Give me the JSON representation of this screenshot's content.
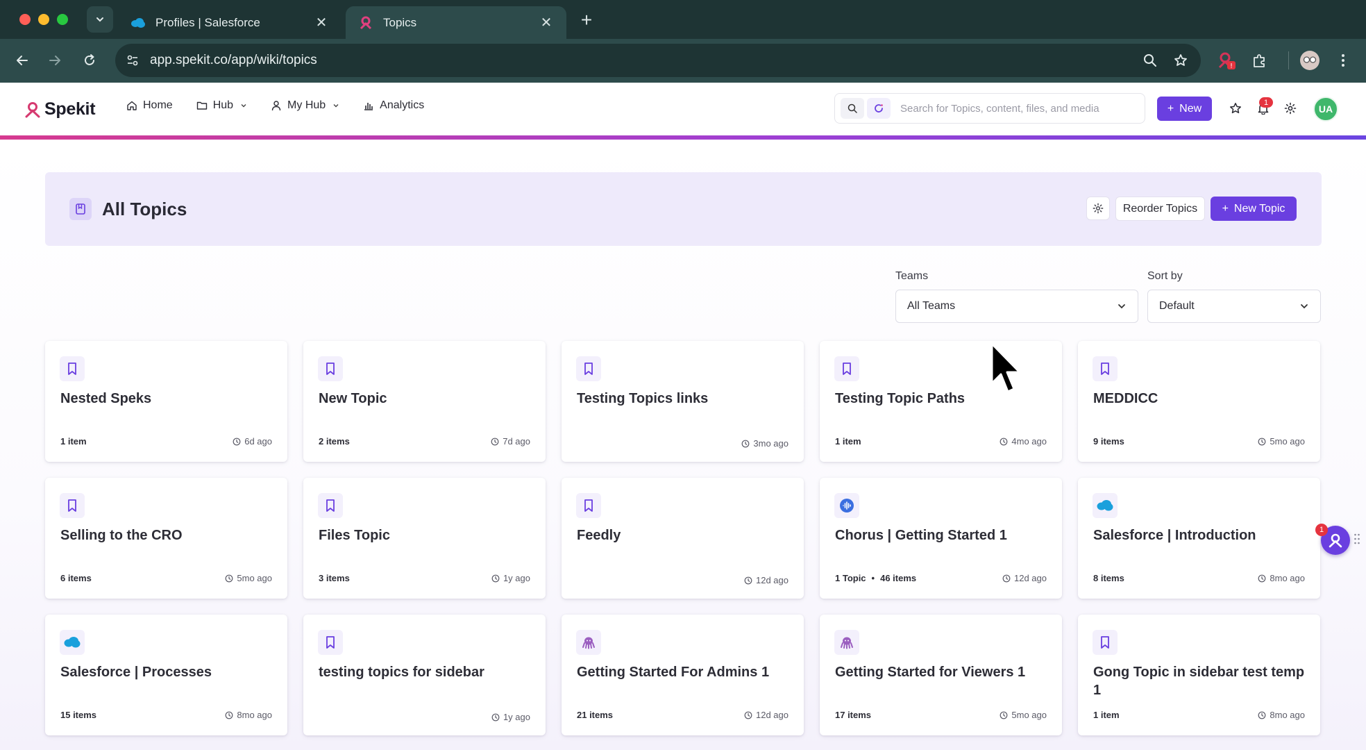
{
  "browser": {
    "tabs": [
      {
        "title": "Profiles | Salesforce",
        "favicon": "salesforce-cloud-icon"
      },
      {
        "title": "Topics",
        "favicon": "spekit-icon",
        "active": true
      }
    ],
    "url": "app.spekit.co/app/wiki/topics",
    "extension_badge": "!"
  },
  "app": {
    "logo_text": "Spekit",
    "nav": [
      {
        "label": "Home",
        "icon": "home-icon"
      },
      {
        "label": "Hub",
        "icon": "folder-icon",
        "dropdown": true
      },
      {
        "label": "My Hub",
        "icon": "user-icon",
        "dropdown": true
      },
      {
        "label": "Analytics",
        "icon": "bar-chart-icon"
      }
    ],
    "search_placeholder": "Search for Topics, content, files, and media",
    "new_button": "New",
    "notification_count": "1",
    "user_initials": "UA",
    "colors": {
      "primary": "#6a3fe0",
      "avatar": "#3fb76b",
      "hero_bg": "#eeeafb"
    }
  },
  "page": {
    "title": "All Topics",
    "reorder_label": "Reorder Topics",
    "new_topic_label": "New Topic",
    "filters": {
      "teams_label": "Teams",
      "teams_value": "All Teams",
      "sort_label": "Sort by",
      "sort_value": "Default"
    }
  },
  "topics": [
    {
      "title": "Nested Speks",
      "items": "1 item",
      "time": "6d ago",
      "icon": "bookmark-icon"
    },
    {
      "title": "New Topic",
      "items": "2 items",
      "time": "7d ago",
      "icon": "bookmark-icon"
    },
    {
      "title": "Testing Topics links",
      "items": "",
      "time": "3mo ago",
      "icon": "bookmark-icon"
    },
    {
      "title": "Testing Topic Paths",
      "items": "1 item",
      "time": "4mo ago",
      "icon": "bookmark-icon"
    },
    {
      "title": "MEDDICC",
      "items": "9 items",
      "time": "5mo ago",
      "icon": "bookmark-icon"
    },
    {
      "title": "Selling to the CRO",
      "items": "6 items",
      "time": "5mo ago",
      "icon": "bookmark-icon"
    },
    {
      "title": "Files Topic",
      "items": "3 items",
      "time": "1y ago",
      "icon": "bookmark-icon"
    },
    {
      "title": "Feedly",
      "items": "",
      "time": "12d ago",
      "icon": "bookmark-icon"
    },
    {
      "title": "Chorus | Getting Started 1",
      "items": "1 Topic",
      "items_secondary": "46 items",
      "time": "12d ago",
      "icon": "chorus-icon"
    },
    {
      "title": "Salesforce | Introduction",
      "items": "8 items",
      "time": "8mo ago",
      "icon": "salesforce-icon"
    },
    {
      "title": "Salesforce | Processes",
      "items": "15 items",
      "time": "8mo ago",
      "icon": "salesforce-icon"
    },
    {
      "title": "testing topics for sidebar",
      "items": "",
      "time": "1y ago",
      "icon": "bookmark-icon"
    },
    {
      "title": "Getting Started For Admins 1",
      "items": "21 items",
      "time": "12d ago",
      "icon": "octopus-icon"
    },
    {
      "title": "Getting Started for Viewers 1",
      "items": "17 items",
      "time": "5mo ago",
      "icon": "octopus-icon"
    },
    {
      "title": "Gong Topic in sidebar test temp 1",
      "items": "1 item",
      "time": "8mo ago",
      "icon": "bookmark-icon"
    }
  ],
  "widget": {
    "badge": "1"
  }
}
